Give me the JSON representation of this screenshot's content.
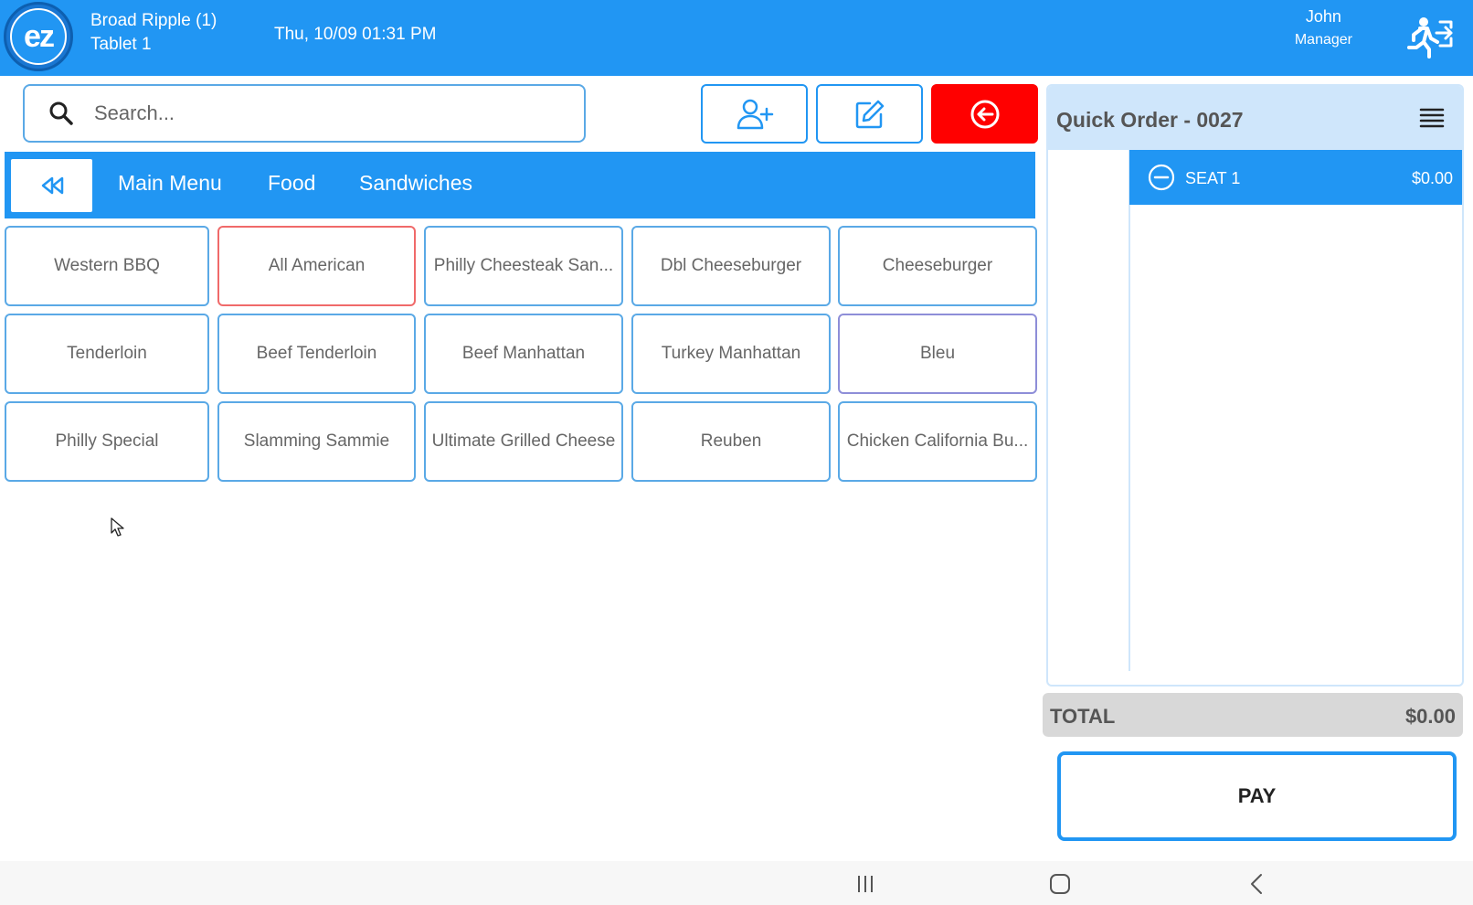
{
  "header": {
    "location": "Broad Ripple (1)",
    "device": "Tablet 1",
    "datetime": "Thu, 10/09 01:31 PM",
    "user_name": "John",
    "user_role": "Manager",
    "logo_text": "ez"
  },
  "search": {
    "placeholder": "Search..."
  },
  "actions": {
    "add_customer_icon": "user-plus-icon",
    "edit_icon": "edit-icon",
    "back_icon": "arrow-left-circle-icon"
  },
  "breadcrumbs": [
    "Main Menu",
    "Food",
    "Sandwiches"
  ],
  "menu_items": [
    [
      "Western BBQ",
      "All American",
      "Philly Cheesteak San...",
      "Dbl Cheeseburger",
      "Cheeseburger"
    ],
    [
      "Tenderloin",
      "Beef Tenderloin",
      "Beef Manhattan",
      "Turkey Manhattan",
      "Bleu"
    ],
    [
      "Philly Special",
      "Slamming Sammie",
      "Ultimate Grilled Cheese",
      "Reuben",
      "Chicken California Bu..."
    ]
  ],
  "order": {
    "title": "Quick Order - 0027",
    "seats": [
      {
        "label": "SEAT 1",
        "amount": "$0.00"
      }
    ],
    "total_label": "TOTAL",
    "total_value": "$0.00",
    "pay_label": "PAY"
  },
  "colors": {
    "primary": "#2196f3",
    "danger": "#ff0000",
    "panel_header": "#cfe6fb",
    "selected_border": "#f06a6a"
  }
}
